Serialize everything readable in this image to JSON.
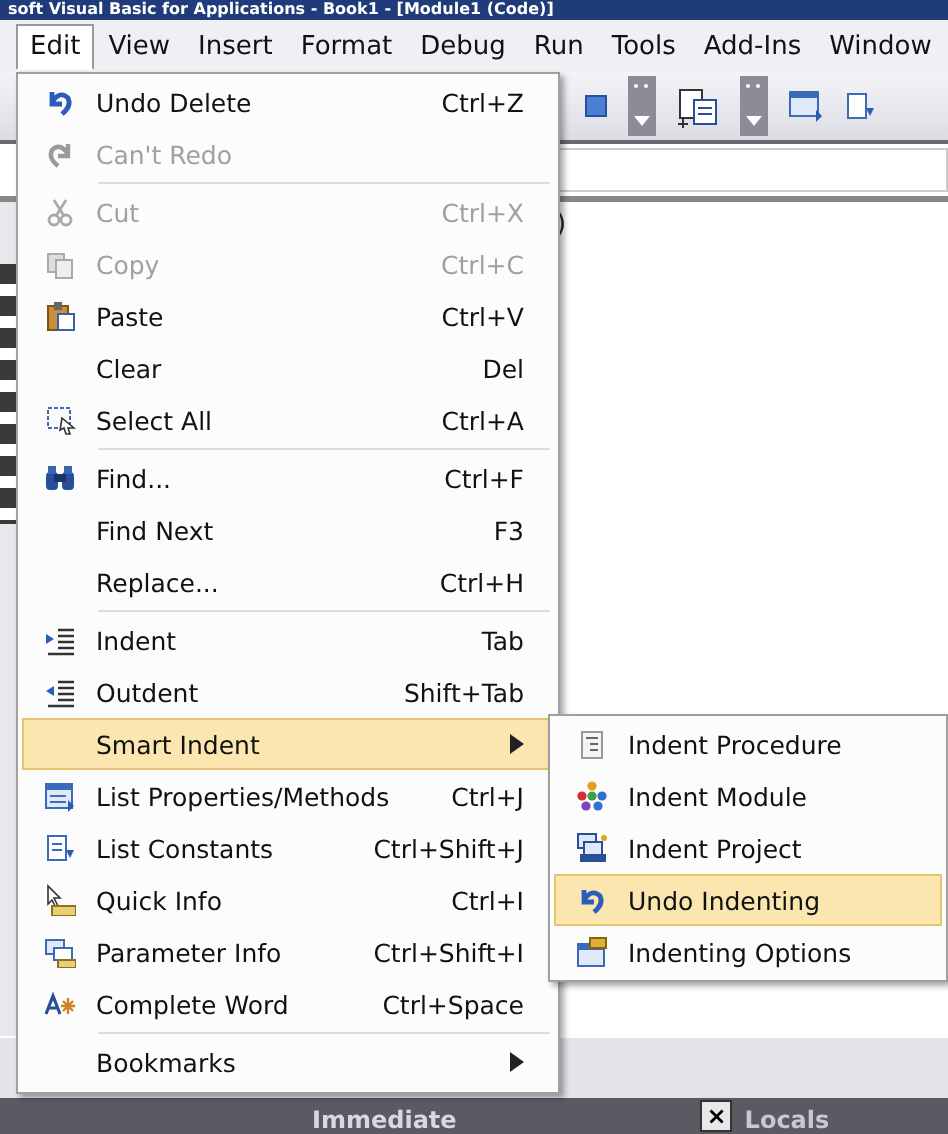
{
  "window": {
    "title": "soft Visual Basic for Applications - Book1 - [Module1 (Code)]"
  },
  "menu_bar": [
    {
      "label": "Edit",
      "selected": true
    },
    {
      "label": "View",
      "selected": false
    },
    {
      "label": "Insert",
      "selected": false
    },
    {
      "label": "Format",
      "selected": false
    },
    {
      "label": "Debug",
      "selected": false
    },
    {
      "label": "Run",
      "selected": false
    },
    {
      "label": "Tools",
      "selected": false
    },
    {
      "label": "Add-Ins",
      "selected": false
    },
    {
      "label": "Window",
      "selected": false
    }
  ],
  "edit_menu": [
    {
      "kind": "command",
      "label": "Undo Delete",
      "shortcut": "Ctrl+Z",
      "disabled": false,
      "selected": false
    },
    {
      "kind": "command",
      "label": "Can't Redo",
      "disabled": true,
      "selected": false,
      "separator_after": true
    },
    {
      "kind": "command",
      "label": "Cut",
      "shortcut": "Ctrl+X",
      "disabled": true,
      "selected": false
    },
    {
      "kind": "command",
      "label": "Copy",
      "shortcut": "Ctrl+C",
      "disabled": true,
      "selected": false
    },
    {
      "kind": "command",
      "label": "Paste",
      "shortcut": "Ctrl+V",
      "disabled": false,
      "selected": false
    },
    {
      "kind": "command",
      "label": "Clear",
      "shortcut": "Del",
      "disabled": false,
      "selected": false
    },
    {
      "kind": "command",
      "label": "Select All",
      "shortcut": "Ctrl+A",
      "disabled": false,
      "selected": false,
      "separator_after": true
    },
    {
      "kind": "command",
      "label": "Find...",
      "shortcut": "Ctrl+F",
      "disabled": false,
      "selected": false
    },
    {
      "kind": "command",
      "label": "Find Next",
      "shortcut": "F3",
      "disabled": false,
      "selected": false
    },
    {
      "kind": "command",
      "label": "Replace...",
      "shortcut": "Ctrl+H",
      "disabled": false,
      "selected": false,
      "separator_after": true
    },
    {
      "kind": "command",
      "label": "Indent",
      "shortcut": "Tab",
      "disabled": false,
      "selected": false
    },
    {
      "kind": "command",
      "label": "Outdent",
      "shortcut": "Shift+Tab",
      "disabled": false,
      "selected": false
    },
    {
      "kind": "submenu",
      "label": "Smart Indent",
      "disabled": false,
      "selected": true
    },
    {
      "kind": "command",
      "label": "List Properties/Methods",
      "shortcut": "Ctrl+J",
      "disabled": false,
      "selected": false
    },
    {
      "kind": "command",
      "label": "List Constants",
      "shortcut": "Ctrl+Shift+J",
      "disabled": false,
      "selected": false
    },
    {
      "kind": "command",
      "label": "Quick Info",
      "shortcut": "Ctrl+I",
      "disabled": false,
      "selected": false
    },
    {
      "kind": "command",
      "label": "Parameter Info",
      "shortcut": "Ctrl+Shift+I",
      "disabled": false,
      "selected": false
    },
    {
      "kind": "command",
      "label": "Complete Word",
      "shortcut": "Ctrl+Space",
      "disabled": false,
      "selected": false,
      "separator_after": true
    },
    {
      "kind": "submenu",
      "label": "Bookmarks",
      "disabled": false,
      "selected": false
    }
  ],
  "smart_indent_menu": [
    {
      "label": "Indent Procedure",
      "selected": false
    },
    {
      "label": "Indent Module",
      "selected": false
    },
    {
      "label": "Indent Project",
      "selected": false
    },
    {
      "label": "Undo Indenting",
      "selected": true
    },
    {
      "label": "Indenting Options",
      "selected": false
    }
  ],
  "code_window": {
    "code_fragment": ")"
  },
  "bottom_panes": [
    {
      "title": "Immediate"
    },
    {
      "title": "Locals",
      "close_label": "×"
    }
  ]
}
